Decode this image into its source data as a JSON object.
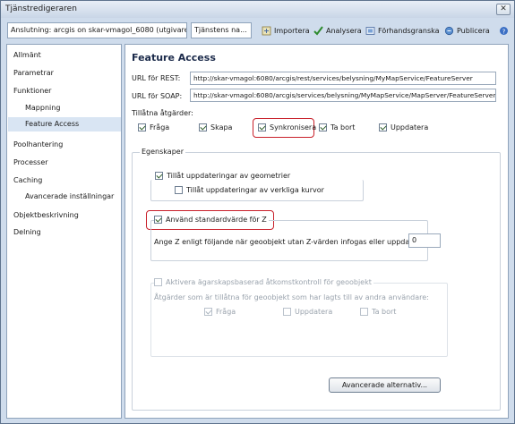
{
  "window": {
    "title": "Tjänstredigeraren",
    "close_glyph": "✕"
  },
  "toolbar": {
    "connection": "Anslutning: arcgis on skar-vmagol_6080 (utgivare)",
    "service": "Tjänstens na...",
    "import_label": "Importera",
    "analyze_label": "Analysera",
    "preview_label": "Förhandsgranska",
    "publish_label": "Publicera",
    "help_glyph": "?"
  },
  "sidebar": {
    "items": [
      {
        "label": "Allmänt"
      },
      {
        "label": "Parametrar"
      },
      {
        "label": "Funktioner"
      },
      {
        "label": "Mappning"
      },
      {
        "label": "Feature Access"
      },
      {
        "label": "Poolhantering"
      },
      {
        "label": "Processer"
      },
      {
        "label": "Caching"
      },
      {
        "label": "Avancerade inställningar"
      },
      {
        "label": "Objektbeskrivning"
      },
      {
        "label": "Delning"
      }
    ]
  },
  "main": {
    "heading": "Feature Access",
    "rest_label": "URL för REST:",
    "rest_url": "http://skar-vmagol:6080/arcgis/rest/services/belysning/MyMapService/FeatureServer",
    "soap_label": "URL för SOAP:",
    "soap_url": "http://skar-vmagol:6080/arcgis/services/belysning/MyMapService/MapServer/FeatureServer",
    "ops_label": "Tillåtna åtgärder:",
    "ops": [
      {
        "label": "Fråga",
        "checked": true
      },
      {
        "label": "Skapa",
        "checked": true
      },
      {
        "label": "Synkronisera",
        "checked": true
      },
      {
        "label": "Ta bort",
        "checked": true
      },
      {
        "label": "Uppdatera",
        "checked": true
      }
    ],
    "props_title": "Egenskaper",
    "allow_geom": "Tillåt uppdateringar av geometrier",
    "allow_true_curves": "Tillåt uppdateringar av verkliga kurvor",
    "use_default_z": "Använd standardvärde för Z",
    "z_text": "Ange Z enligt följande när geoobjekt utan Z-värden infogas eller uppdateras:",
    "z_value": "0",
    "ownership": "Aktivera ägarskapsbaserad åtkomstkontroll för geoobjekt",
    "ownership_desc": "Åtgärder som är tillåtna för geoobjekt som har lagts till av andra användare:",
    "own_ops": [
      {
        "label": "Fråga",
        "checked": true
      },
      {
        "label": "Uppdatera",
        "checked": false
      },
      {
        "label": "Ta bort",
        "checked": false
      }
    ],
    "advanced_button": "Avancerade alternativ..."
  }
}
